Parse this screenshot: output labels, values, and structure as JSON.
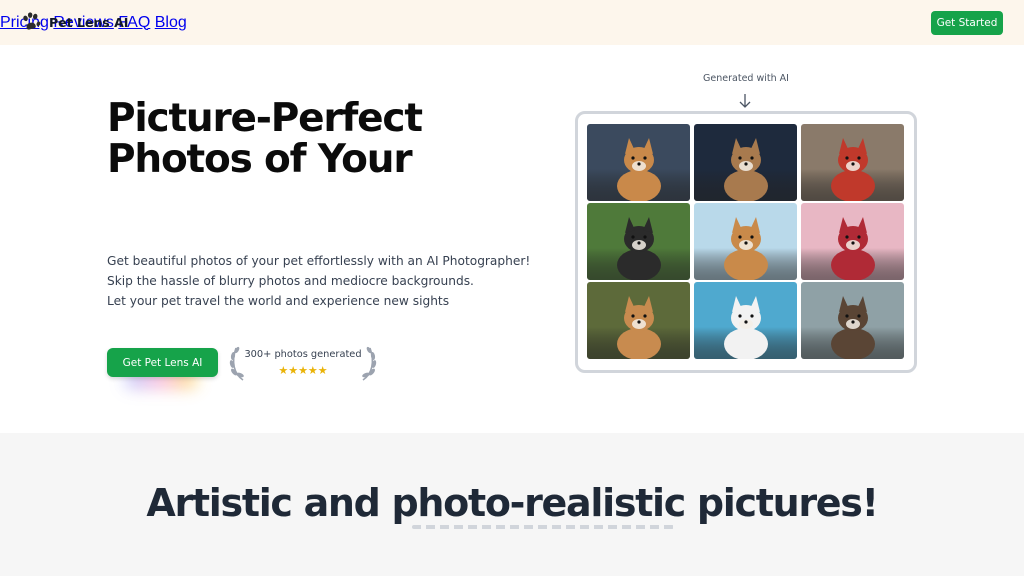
{
  "brand": {
    "name": "Pet Lens AI",
    "icon": "paw-icon"
  },
  "nav": {
    "items": [
      "Pricing",
      "Reviews",
      "FAQ",
      "Blog"
    ]
  },
  "header": {
    "cta_label": "Get Started",
    "accent": "#16a34a"
  },
  "hero": {
    "title_lines": [
      "Picture-Perfect",
      "Photos of Your"
    ],
    "description_lines": [
      "Get beautiful photos of your pet effortlessly with an AI Photographer!",
      "Skip the hassle of blurry photos and mediocre backgrounds.",
      "Let your pet travel the world and experience new sights"
    ],
    "cta_label": "Get Pet Lens AI",
    "social_proof": {
      "text": "300+ photos generated",
      "stars": "★★★★★",
      "rating": 5
    }
  },
  "gallery": {
    "label": "Generated with AI",
    "images": [
      {
        "name": "corgi-portrait",
        "bg": "#3b4a5e",
        "pet": "#c9894a"
      },
      {
        "name": "cat-party-hat",
        "bg": "#1e2a3d",
        "pet": "#a87a4e"
      },
      {
        "name": "boston-terrier-sweater",
        "bg": "#8a7a6a",
        "pet": "#c0392b"
      },
      {
        "name": "husky-puppy-grass",
        "bg": "#4f7a3a",
        "pet": "#2b2b2b"
      },
      {
        "name": "corgi-surfing",
        "bg": "#b9d9ea",
        "pet": "#c98a4a"
      },
      {
        "name": "shiba-kimono",
        "bg": "#e8b7c4",
        "pet": "#b02a36"
      },
      {
        "name": "kitten-meadow",
        "bg": "#5d6a3a",
        "pet": "#c88b4f"
      },
      {
        "name": "terrier-swimming",
        "bg": "#4fa9cf",
        "pet": "#f2f2f2"
      },
      {
        "name": "dog-manor",
        "bg": "#8fa1a6",
        "pet": "#5a4535"
      }
    ]
  },
  "section2": {
    "title": "Artistic and photo-realistic pictures!"
  }
}
